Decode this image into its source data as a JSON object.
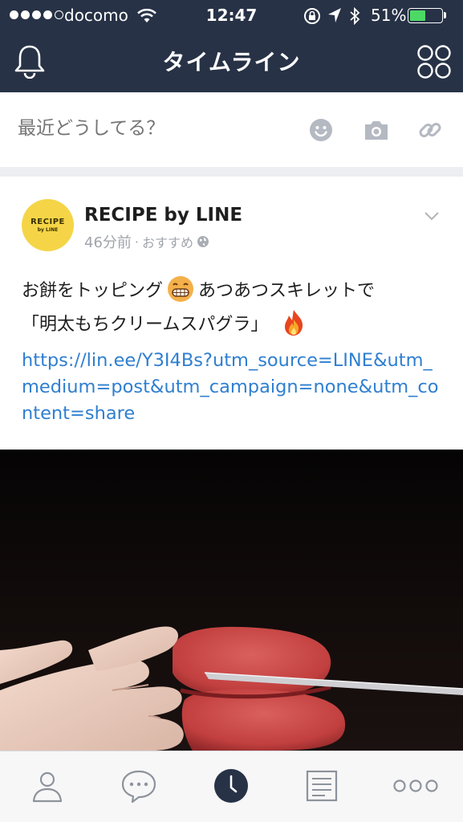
{
  "status_bar": {
    "carrier": "docomo",
    "time": "12:47",
    "battery_percent": "51%",
    "battery_level": 0.51,
    "signal_bars": 4,
    "icons": [
      "wifi-icon",
      "rotation-lock-icon",
      "location-icon",
      "bluetooth-icon",
      "battery-icon"
    ]
  },
  "header": {
    "title": "タイムライン",
    "left_icon": "bell-icon",
    "right_icon": "grid-icon"
  },
  "composer": {
    "placeholder": "最近どうしてる？",
    "icons": [
      "sticker-icon",
      "camera-icon",
      "link-icon"
    ]
  },
  "post": {
    "author": "RECIPE by LINE",
    "avatar_text": [
      "RECIPE",
      "by LINE"
    ],
    "time": "46分前",
    "separator": "·",
    "tag": "おすすめ",
    "text_line1_a": "お餅をトッピング",
    "text_line1_b": "あつあつスキレットで",
    "text_line2": "「明太もちクリームスパグラ」",
    "link": "https://lin.ee/Y3I4Bs?utm_source=LINE&utm_medium=post&utm_campaign=none&utm_content=share"
  },
  "tabbar": {
    "items": [
      "friends-icon",
      "chats-icon",
      "timeline-icon",
      "news-icon",
      "more-icon"
    ],
    "active": "timeline-icon"
  },
  "colors": {
    "header_bg": "#273246",
    "link": "#2f7fd0",
    "battery": "#4cd964",
    "avatar_bg": "#f5d547"
  }
}
